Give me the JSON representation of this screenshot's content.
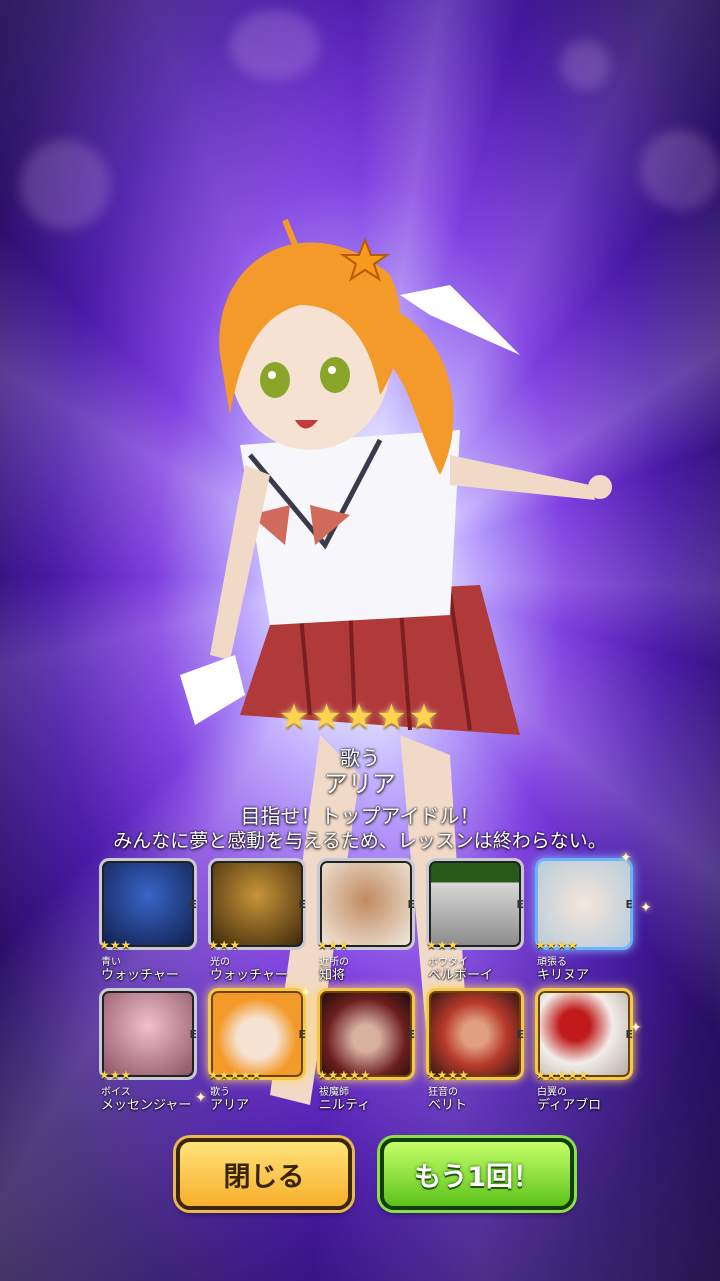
{
  "featured": {
    "stars": "★★★★★",
    "subtitle": "歌う",
    "name": "アリア",
    "quote_line1": "目指せ！トップアイドル！",
    "quote_line2": "みんなに夢と感動を与えるため、レッスンは終わらない。"
  },
  "results": [
    [
      {
        "stars": "★★★",
        "sub": "青い",
        "name": "ウォッチャー",
        "element": "E",
        "color": "#1a3d8a"
      },
      {
        "stars": "★★★",
        "sub": "光の",
        "name": "ウォッチャー",
        "element": "E",
        "color": "#7a5a1e"
      },
      {
        "stars": "★★★",
        "sub": "近所の",
        "name": "知将",
        "element": "E",
        "color": "#c89a6a"
      },
      {
        "stars": "★★★",
        "sub": "ボウタイ",
        "name": "ベルボーイ",
        "element": "E",
        "color": "#8a8a8a"
      },
      {
        "stars": "★★★★",
        "sub": "頑張る",
        "name": "キリヌア",
        "element": "E",
        "color": "#cfe0ea"
      }
    ],
    [
      {
        "stars": "★★★",
        "sub": "ボイス",
        "name": "メッセンジャー",
        "element": "E",
        "color": "#e0b0c0"
      },
      {
        "stars": "★★★★★",
        "sub": "歌う",
        "name": "アリア",
        "element": "E",
        "color": "#f3a23a"
      },
      {
        "stars": "★★★★★",
        "sub": "祓魔師",
        "name": "ニルティ",
        "element": "E",
        "color": "#6a2a2a"
      },
      {
        "stars": "★★★★",
        "sub": "狂音の",
        "name": "ベリト",
        "element": "E",
        "color": "#8a3a2a"
      },
      {
        "stars": "★★★★★",
        "sub": "白翼の",
        "name": "ディアブロ",
        "element": "E",
        "color": "#e6e0dc"
      }
    ]
  ],
  "buttons": {
    "close": "閉じる",
    "again": "もう1回！"
  }
}
